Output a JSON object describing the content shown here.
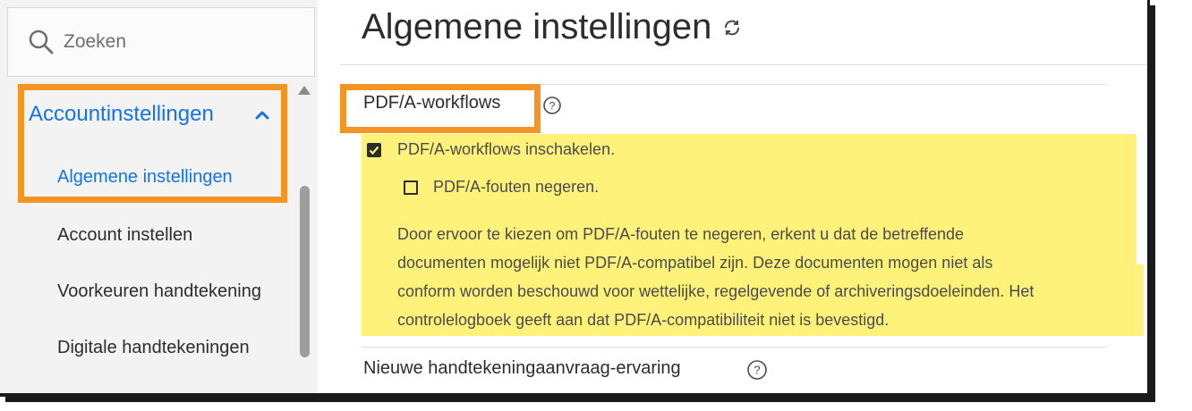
{
  "search": {
    "placeholder": "Zoeken"
  },
  "sidebar": {
    "section_label": "Accountinstellingen",
    "items": [
      {
        "label": "Algemene instellingen",
        "active": true
      },
      {
        "label": "Account instellen",
        "active": false
      },
      {
        "label": "Voorkeuren handtekening",
        "active": false
      },
      {
        "label": "Digitale handtekeningen",
        "active": false
      }
    ]
  },
  "main": {
    "title": "Algemene instellingen",
    "section1": {
      "title": "PDF/A-workflows",
      "option1": {
        "label": "PDF/A-workflows inschakelen.",
        "checked": true
      },
      "option2": {
        "label": "PDF/A-fouten negeren.",
        "checked": false
      },
      "description_lines": [
        "Door ervoor te kiezen om PDF/A-fouten te negeren, erkent u dat de betreffende",
        "documenten mogelijk niet PDF/A-compatibel zijn. Deze documenten mogen niet als",
        "conform worden beschouwd voor wettelijke, regelgevende of archiveringsdoeleinden. Het",
        "controlelogboek geeft aan dat PDF/A-compatibiliteit niet is bevestigd."
      ]
    },
    "section2": {
      "title": "Nieuwe handtekeningaanvraag-ervaring"
    }
  },
  "colors": {
    "accent": "#1473e6",
    "highlight_border": "#f39423",
    "highlight_fill": "#fff27a"
  }
}
